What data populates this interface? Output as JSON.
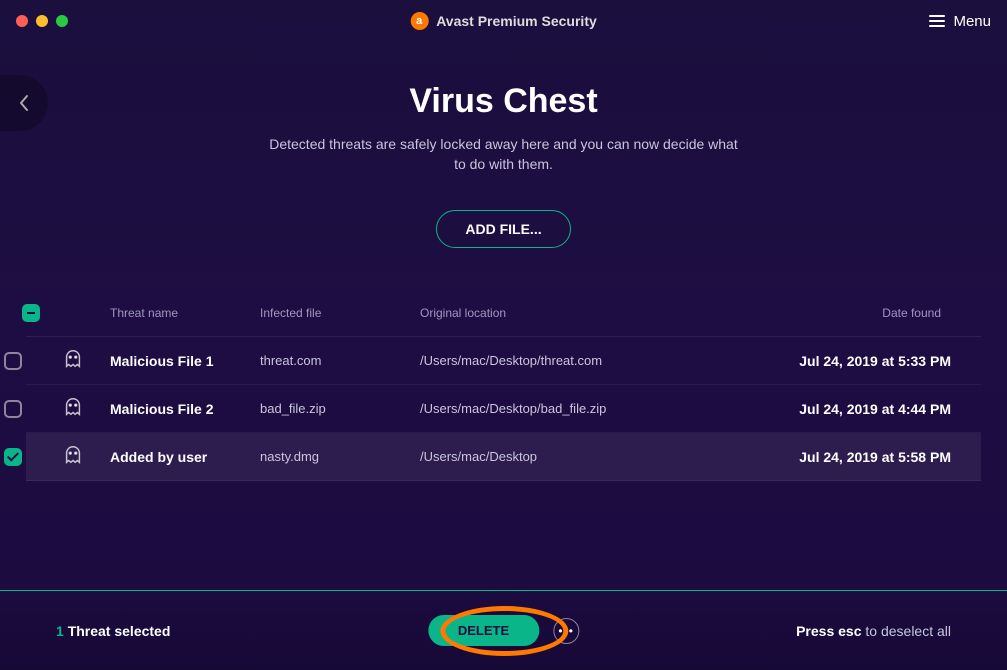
{
  "app": {
    "title": "Avast Premium Security",
    "menu_label": "Menu"
  },
  "page": {
    "heading": "Virus Chest",
    "subtitle": "Detected threats are safely locked away here and you can now decide what to do with them.",
    "add_file_label": "ADD FILE..."
  },
  "table": {
    "headers": {
      "threat_name": "Threat name",
      "infected_file": "Infected file",
      "original_location": "Original location",
      "date_found": "Date found"
    },
    "rows": [
      {
        "name": "Malicious File 1",
        "file": "threat.com",
        "location": "/Users/mac/Desktop/threat.com",
        "date": "Jul 24, 2019 at 5:33 PM",
        "checked": false
      },
      {
        "name": "Malicious File 2",
        "file": "bad_file.zip",
        "location": "/Users/mac/Desktop/bad_file.zip",
        "date": "Jul 24, 2019 at 4:44 PM",
        "checked": false
      },
      {
        "name": "Added by user",
        "file": "nasty.dmg",
        "location": "/Users/mac/Desktop",
        "date": "Jul 24, 2019 at 5:58 PM",
        "checked": true
      }
    ]
  },
  "footer": {
    "selected_count": "1",
    "selected_label": "Threat selected",
    "delete_label": "DELETE",
    "deselect_prefix": "Press esc",
    "deselect_suffix": " to deselect all"
  }
}
